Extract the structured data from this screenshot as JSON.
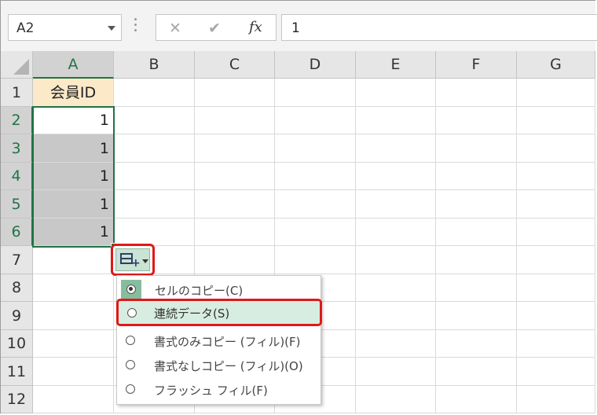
{
  "formula_bar": {
    "name_box": "A2",
    "cancel_symbol": "✕",
    "enter_symbol": "✔",
    "function_symbol": "fx",
    "formula_value": "1"
  },
  "columns": [
    "A",
    "B",
    "C",
    "D",
    "E",
    "F",
    "G"
  ],
  "rows": [
    "1",
    "2",
    "3",
    "4",
    "5",
    "6",
    "7",
    "8",
    "9",
    "10",
    "11",
    "12"
  ],
  "cells": {
    "A1": "会員ID",
    "A2": "1",
    "A3": "1",
    "A4": "1",
    "A5": "1",
    "A6": "1"
  },
  "autofill_menu": {
    "items": [
      {
        "label": "セルのコピー(C)",
        "selected": true
      },
      {
        "label": "連続データ(S)",
        "selected": false
      },
      {
        "label": "書式のみコピー (フィル)(F)",
        "selected": false
      },
      {
        "label": "書式なしコピー (フィル)(O)",
        "selected": false
      },
      {
        "label": "フラッシュ フィル(F)",
        "selected": false
      }
    ]
  },
  "colors": {
    "selection_green": "#217346",
    "header_cell_fill": "#fbe9c8",
    "fill_gray": "#c8c8c8",
    "highlight_red": "#e01818"
  }
}
